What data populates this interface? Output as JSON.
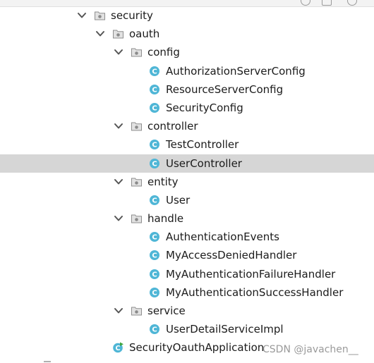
{
  "tree": {
    "rows": [
      {
        "name": "tree-node-security",
        "kind": "folder",
        "expanded": true,
        "label": "security"
      },
      {
        "name": "tree-node-oauth",
        "kind": "folder",
        "expanded": true,
        "label": "oauth"
      },
      {
        "name": "tree-node-config",
        "kind": "folder",
        "expanded": true,
        "label": "config"
      },
      {
        "name": "tree-node-authorizationserverconfig",
        "kind": "class",
        "label": "AuthorizationServerConfig"
      },
      {
        "name": "tree-node-resourceserverconfig",
        "kind": "class",
        "label": "ResourceServerConfig"
      },
      {
        "name": "tree-node-securityconfig",
        "kind": "class",
        "label": "SecurityConfig"
      },
      {
        "name": "tree-node-controller",
        "kind": "folder",
        "expanded": true,
        "label": "controller"
      },
      {
        "name": "tree-node-testcontroller",
        "kind": "class",
        "label": "TestController"
      },
      {
        "name": "tree-node-usercontroller",
        "kind": "class",
        "label": "UserController",
        "selected": true
      },
      {
        "name": "tree-node-entity",
        "kind": "folder",
        "expanded": true,
        "label": "entity"
      },
      {
        "name": "tree-node-user",
        "kind": "class",
        "label": "User"
      },
      {
        "name": "tree-node-handle",
        "kind": "folder",
        "expanded": true,
        "label": "handle"
      },
      {
        "name": "tree-node-authenticationevents",
        "kind": "class",
        "label": "AuthenticationEvents"
      },
      {
        "name": "tree-node-myaccessdeniedhandler",
        "kind": "class",
        "label": "MyAccessDeniedHandler"
      },
      {
        "name": "tree-node-myauthenticationfailurehandler",
        "kind": "class",
        "label": "MyAuthenticationFailureHandler"
      },
      {
        "name": "tree-node-myauthenticationsuccesshandler",
        "kind": "class",
        "label": "MyAuthenticationSuccessHandler"
      },
      {
        "name": "tree-node-service",
        "kind": "folder",
        "expanded": true,
        "label": "service"
      },
      {
        "name": "tree-node-userdetailserviceimpl",
        "kind": "class",
        "label": "UserDetailServiceImpl"
      },
      {
        "name": "tree-node-securityoauthapplication",
        "kind": "app",
        "label": "SecurityOauthApplication"
      }
    ]
  },
  "watermark": {
    "text": "CSDN @javachen__"
  },
  "colors": {
    "selected_row": "#d6d6d6",
    "class_icon": "#4fb6d6",
    "folder_icon": "#9a9a9a",
    "app_icon_badge": "#3fa53f"
  }
}
